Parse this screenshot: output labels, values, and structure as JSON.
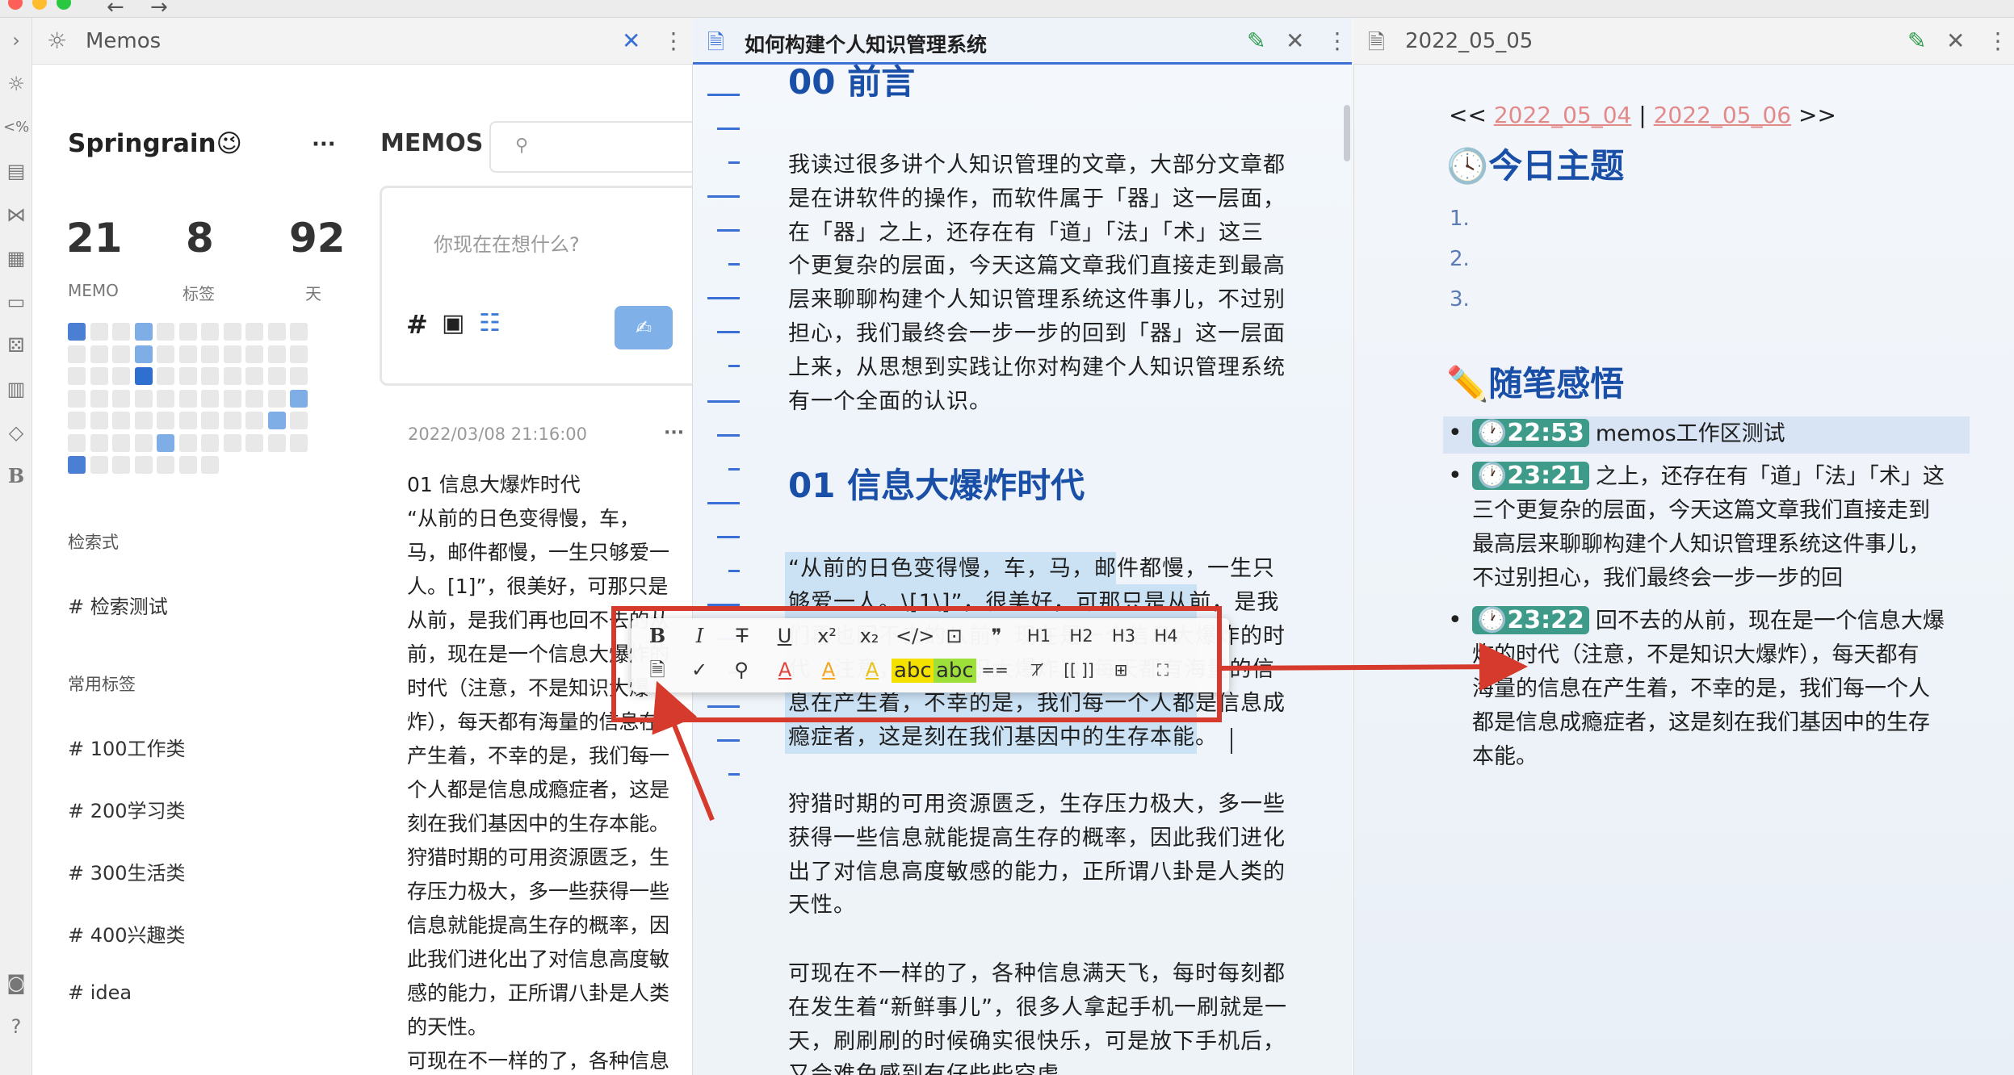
{
  "window": {
    "back_icon": "back-arrow-icon",
    "forward_icon": "forward-arrow-icon"
  },
  "memos_pane": {
    "tab_title": "Memos",
    "user_name": "Springrain😉",
    "more": "···",
    "stats": [
      {
        "value": "21",
        "label": "MEMO"
      },
      {
        "value": "8",
        "label": "标签"
      },
      {
        "value": "92",
        "label": "天"
      }
    ],
    "heatmap_highlights": [
      0,
      3,
      14,
      25,
      43,
      53,
      59
    ],
    "heatmap_dark": [
      25
    ],
    "section_queries": "检索式",
    "query_items": [
      "# 检索测试"
    ],
    "section_tags": "常用标签",
    "tags": [
      "# 100工作类",
      "# 200学习类",
      "# 300生活类",
      "# 400兴趣类",
      "# idea"
    ],
    "memos_title": "MEMOS",
    "search_placeholder": "",
    "editor_placeholder": "你现在在想什么?",
    "memo": {
      "time": "2022/03/08 21:16:00",
      "more": "···",
      "lines": [
        "01 信息大爆炸时代",
        "“从前的日色变得慢，车，",
        "马，邮件都慢，一生只够爱一",
        "人。[1]”，很美好，可那只是",
        "从前，是我们再也回不去的从",
        "前，现在是一个信息大爆炸的",
        "时代（注意，不是知识大爆",
        "炸），每天都有海量的信息在",
        "产生着，不幸的是，我们每一",
        "个人都是信息成瘾症者，这是",
        "刻在我们基因中的生存本能。",
        "狩猎时期的可用资源匮乏，生",
        "存压力极大，多一些获得一些",
        "信息就能提高生存的概率，因",
        "此我们进化出了对信息高度敏",
        "感的能力，正所谓八卦是人类",
        "的天性。",
        "可现在不一样的了，各种信息"
      ]
    }
  },
  "editor_pane": {
    "tab_title": "如何构建个人知识管理系统",
    "heading_00": "00 前言",
    "para1": [
      "我读过很多讲个人知识管理的文章，大部分文章都",
      "是在讲软件的操作，而软件属于「器」这一层面，",
      "在「器」之上，还存在有「道」「法」「术」这三",
      "个更复杂的层面，今天这篇文章我们直接走到最高",
      "层来聊聊构建个人知识管理系统这件事儿，不过别",
      "担心，我们最终会一步一步的回到「器」这一层面",
      "上来，从思想到实践让你对构建个人知识管理系统",
      "有一个全面的认识。"
    ],
    "heading_01": "01 信息大爆炸时代",
    "para2": [
      "“从前的日色变得慢，车，马，邮件都慢，一生只",
      "够爱一人。\\[1\\]”，很美好，可那只是从前，是我",
      "们再也回不去的从前，现在是一个信息大爆炸的时",
      "代（注意，不是知识大爆炸），每天都有海量的信",
      "息在产生着，不幸的是，我们每一个人都是信息成",
      "瘾症者，这是刻在我们基因中的生存本能。"
    ],
    "para3": [
      "狩猎时期的可用资源匮乏，生存压力极大，多一些",
      "获得一些信息就能提高生存的概率，因此我们进化",
      "出了对信息高度敏感的能力，正所谓八卦是人类的",
      "天性。"
    ],
    "para4": [
      "可现在不一样的了，各种信息满天飞，每时每刻都",
      "在发生着“新鲜事儿”，很多人拿起手机一刷就是一",
      "天，刷刷刷的时候确实很快乐，可是放下手机后，",
      "又会难免感到有仔些些空虚"
    ]
  },
  "toolbar": {
    "row1": [
      "B",
      "I",
      "T",
      "U",
      "x²",
      "x₂",
      "</>",
      "⊡",
      "❞",
      "H1",
      "H2",
      "H3",
      "H4"
    ],
    "row2_icons": [
      "doc-add-icon",
      "check-icon",
      "search-icon"
    ],
    "row2_colors": [
      "A",
      "A",
      "A"
    ],
    "row2_color_values": [
      "#e0463b",
      "#f5a623",
      "#e8c21a"
    ],
    "highlight1": "abc",
    "highlight2": "abc",
    "row2_tail": [
      "==",
      "⊤̸",
      "[[ ]]",
      "⊞",
      "⛶"
    ]
  },
  "daily_pane": {
    "tab_title": "2022_05_05",
    "nav_prev_prefix": "<<",
    "nav_prev": "2022_05_04",
    "nav_sep": "|",
    "nav_next": "2022_05_06",
    "nav_next_suffix": ">>",
    "theme_heading": "🕓今日主题",
    "theme_items": [
      "1.",
      "2.",
      "3."
    ],
    "notes_heading": "✏️随笔感悟",
    "entries": [
      {
        "time": "🕐22:53",
        "lines": [
          "memos工作区测试"
        ]
      },
      {
        "time": "🕐23:21",
        "lines": [
          "之上，还存在有「道」「法」「术」这",
          "三个更复杂的层面，今天这篇文章我们直接走到",
          "最高层来聊聊构建个人知识管理系统这件事儿，",
          "不过别担心，我们最终会一步一步的回"
        ]
      },
      {
        "time": "🕐23:22",
        "lines": [
          "回不去的从前，现在是一个信息大爆",
          "炸的时代（注意，不是知识大爆炸），每天都有",
          "海量的信息在产生着，不幸的是，我们每一个人",
          "都是信息成瘾症者，这是刻在我们基因中的生存",
          "本能。"
        ]
      }
    ]
  },
  "colors": {
    "accent": "#1a4fa8",
    "link": "#e28a8a",
    "timestamp_bg": "#3e9b8a",
    "annotation": "#d63a2c",
    "heat": "#4a7fd4"
  }
}
